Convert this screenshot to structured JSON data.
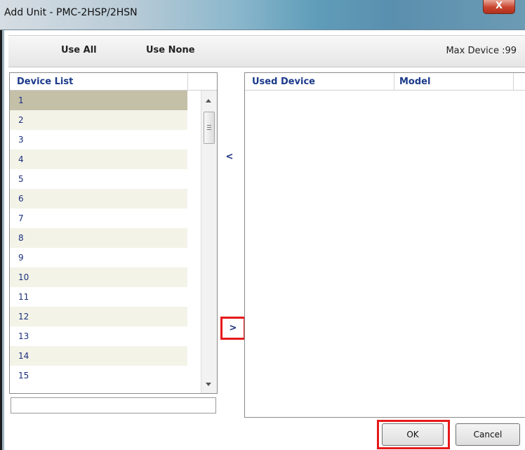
{
  "window": {
    "title": "Add Unit - PMC-2HSP/2HSN",
    "close_label": "X"
  },
  "toolbar": {
    "use_all_label": "Use All",
    "use_none_label": "Use None",
    "max_device_label": "Max Device :99"
  },
  "device_list": {
    "header": "Device List",
    "selected_index": 0,
    "items": [
      "1",
      "2",
      "3",
      "4",
      "5",
      "6",
      "7",
      "8",
      "9",
      "10",
      "11",
      "12",
      "13",
      "14",
      "15"
    ]
  },
  "used_devices": {
    "headers": [
      "Used Device",
      "Model"
    ],
    "rows": []
  },
  "transfer": {
    "move_left_label": "<",
    "move_right_label": ">"
  },
  "footer": {
    "ok_label": "OK",
    "cancel_label": "Cancel"
  },
  "colors": {
    "highlight_border": "#e61a1a",
    "list_text": "#1b2f7c",
    "selected_row": "#c4c0a8",
    "alt_row": "#f3f3e8"
  }
}
